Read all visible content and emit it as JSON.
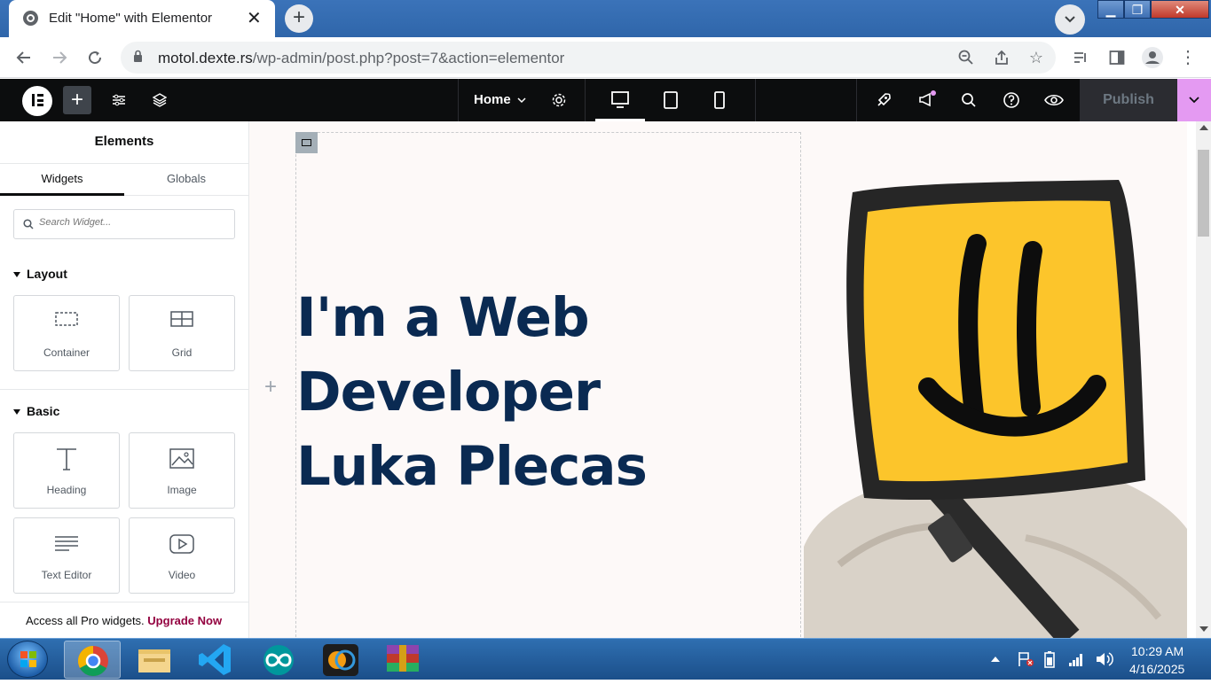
{
  "browser": {
    "tab_title": "Edit \"Home\" with Elementor",
    "url_domain": "motol.dexte.rs",
    "url_path": "/wp-admin/post.php?post=7&action=elementor"
  },
  "elementor": {
    "page_name": "Home",
    "publish_label": "Publish"
  },
  "panel": {
    "title": "Elements",
    "tabs": [
      "Widgets",
      "Globals"
    ],
    "search_placeholder": "Search Widget...",
    "sections": {
      "layout": {
        "title": "Layout",
        "widgets": [
          "Container",
          "Grid"
        ]
      },
      "basic": {
        "title": "Basic",
        "widgets": [
          "Heading",
          "Image",
          "Text Editor",
          "Video"
        ]
      }
    },
    "promo_text": "Access all Pro widgets.",
    "promo_link": "Upgrade Now"
  },
  "canvas": {
    "headline_lines": [
      "I'm a Web",
      "Developer",
      "Luka Plecas"
    ]
  },
  "taskbar": {
    "time": "10:29 AM",
    "date": "4/16/2025"
  },
  "colors": {
    "headline": "#0a2a52",
    "publish_accent": "#e49af2",
    "promo_link": "#93003f",
    "canvas_bg": "#fdf9f8"
  }
}
